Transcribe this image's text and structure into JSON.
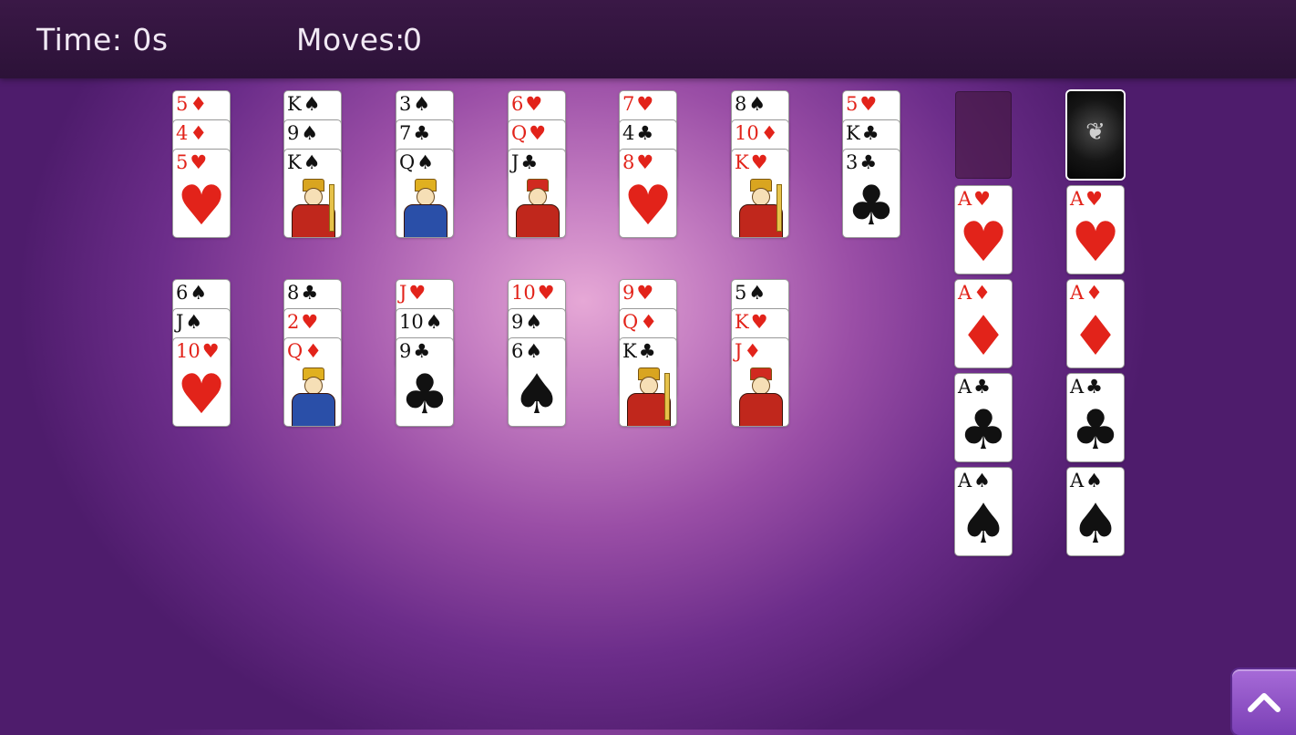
{
  "hud": {
    "time_label": "Time: 0s",
    "moves_label": "Moves:",
    "moves_value": "0"
  },
  "colors": {
    "red": "#e2231a",
    "black": "#111111",
    "topbar": "#2c1238"
  },
  "tableau": [
    [
      {
        "rank": "5",
        "suit": "♦",
        "color": "red"
      },
      {
        "rank": "4",
        "suit": "♦",
        "color": "red"
      },
      {
        "rank": "5",
        "suit": "♥",
        "color": "red",
        "face": "pip"
      }
    ],
    [
      {
        "rank": "K",
        "suit": "♠",
        "color": "black"
      },
      {
        "rank": "9",
        "suit": "♠",
        "color": "black"
      },
      {
        "rank": "K",
        "suit": "♠",
        "color": "black",
        "face": "king"
      }
    ],
    [
      {
        "rank": "3",
        "suit": "♠",
        "color": "black"
      },
      {
        "rank": "7",
        "suit": "♣",
        "color": "black"
      },
      {
        "rank": "Q",
        "suit": "♠",
        "color": "black",
        "face": "queen"
      }
    ],
    [
      {
        "rank": "6",
        "suit": "♥",
        "color": "red"
      },
      {
        "rank": "Q",
        "suit": "♥",
        "color": "red"
      },
      {
        "rank": "J",
        "suit": "♣",
        "color": "black",
        "face": "jack"
      }
    ],
    [
      {
        "rank": "7",
        "suit": "♥",
        "color": "red"
      },
      {
        "rank": "4",
        "suit": "♣",
        "color": "black"
      },
      {
        "rank": "8",
        "suit": "♥",
        "color": "red",
        "face": "pip"
      }
    ],
    [
      {
        "rank": "8",
        "suit": "♠",
        "color": "black"
      },
      {
        "rank": "10",
        "suit": "♦",
        "color": "red"
      },
      {
        "rank": "K",
        "suit": "♥",
        "color": "red",
        "face": "king"
      }
    ],
    [
      {
        "rank": "5",
        "suit": "♥",
        "color": "red"
      },
      {
        "rank": "K",
        "suit": "♣",
        "color": "black"
      },
      {
        "rank": "3",
        "suit": "♣",
        "color": "black",
        "face": "pip"
      }
    ],
    [
      {
        "rank": "6",
        "suit": "♠",
        "color": "black"
      },
      {
        "rank": "J",
        "suit": "♠",
        "color": "black"
      },
      {
        "rank": "10",
        "suit": "♥",
        "color": "red",
        "face": "pip"
      }
    ],
    [
      {
        "rank": "8",
        "suit": "♣",
        "color": "black"
      },
      {
        "rank": "2",
        "suit": "♥",
        "color": "red"
      },
      {
        "rank": "Q",
        "suit": "♦",
        "color": "red",
        "face": "queen"
      }
    ],
    [
      {
        "rank": "J",
        "suit": "♥",
        "color": "red"
      },
      {
        "rank": "10",
        "suit": "♠",
        "color": "black"
      },
      {
        "rank": "9",
        "suit": "♣",
        "color": "black",
        "face": "pip"
      }
    ],
    [
      {
        "rank": "10",
        "suit": "♥",
        "color": "red"
      },
      {
        "rank": "9",
        "suit": "♠",
        "color": "black"
      },
      {
        "rank": "6",
        "suit": "♠",
        "color": "black",
        "face": "pip"
      }
    ],
    [
      {
        "rank": "9",
        "suit": "♥",
        "color": "red"
      },
      {
        "rank": "Q",
        "suit": "♦",
        "color": "red"
      },
      {
        "rank": "K",
        "suit": "♣",
        "color": "black",
        "face": "king"
      }
    ],
    [
      {
        "rank": "5",
        "suit": "♠",
        "color": "black"
      },
      {
        "rank": "K",
        "suit": "♥",
        "color": "red"
      },
      {
        "rank": "J",
        "suit": "♦",
        "color": "red",
        "face": "jack"
      }
    ]
  ],
  "foundations": [
    [
      {
        "rank": "A",
        "suit": "♥",
        "color": "red"
      },
      {
        "rank": "A",
        "suit": "♦",
        "color": "red"
      },
      {
        "rank": "A",
        "suit": "♣",
        "color": "black"
      },
      {
        "rank": "A",
        "suit": "♠",
        "color": "black"
      }
    ],
    [
      {
        "rank": "A",
        "suit": "♥",
        "color": "red"
      },
      {
        "rank": "A",
        "suit": "♦",
        "color": "red"
      },
      {
        "rank": "A",
        "suit": "♣",
        "color": "black"
      },
      {
        "rank": "A",
        "suit": "♠",
        "color": "black"
      }
    ]
  ],
  "stock": {
    "state": "face-down",
    "icon": "ornament-icon"
  },
  "waste": {
    "state": "empty"
  },
  "menu_button": {
    "icon": "chevron-up-icon"
  }
}
